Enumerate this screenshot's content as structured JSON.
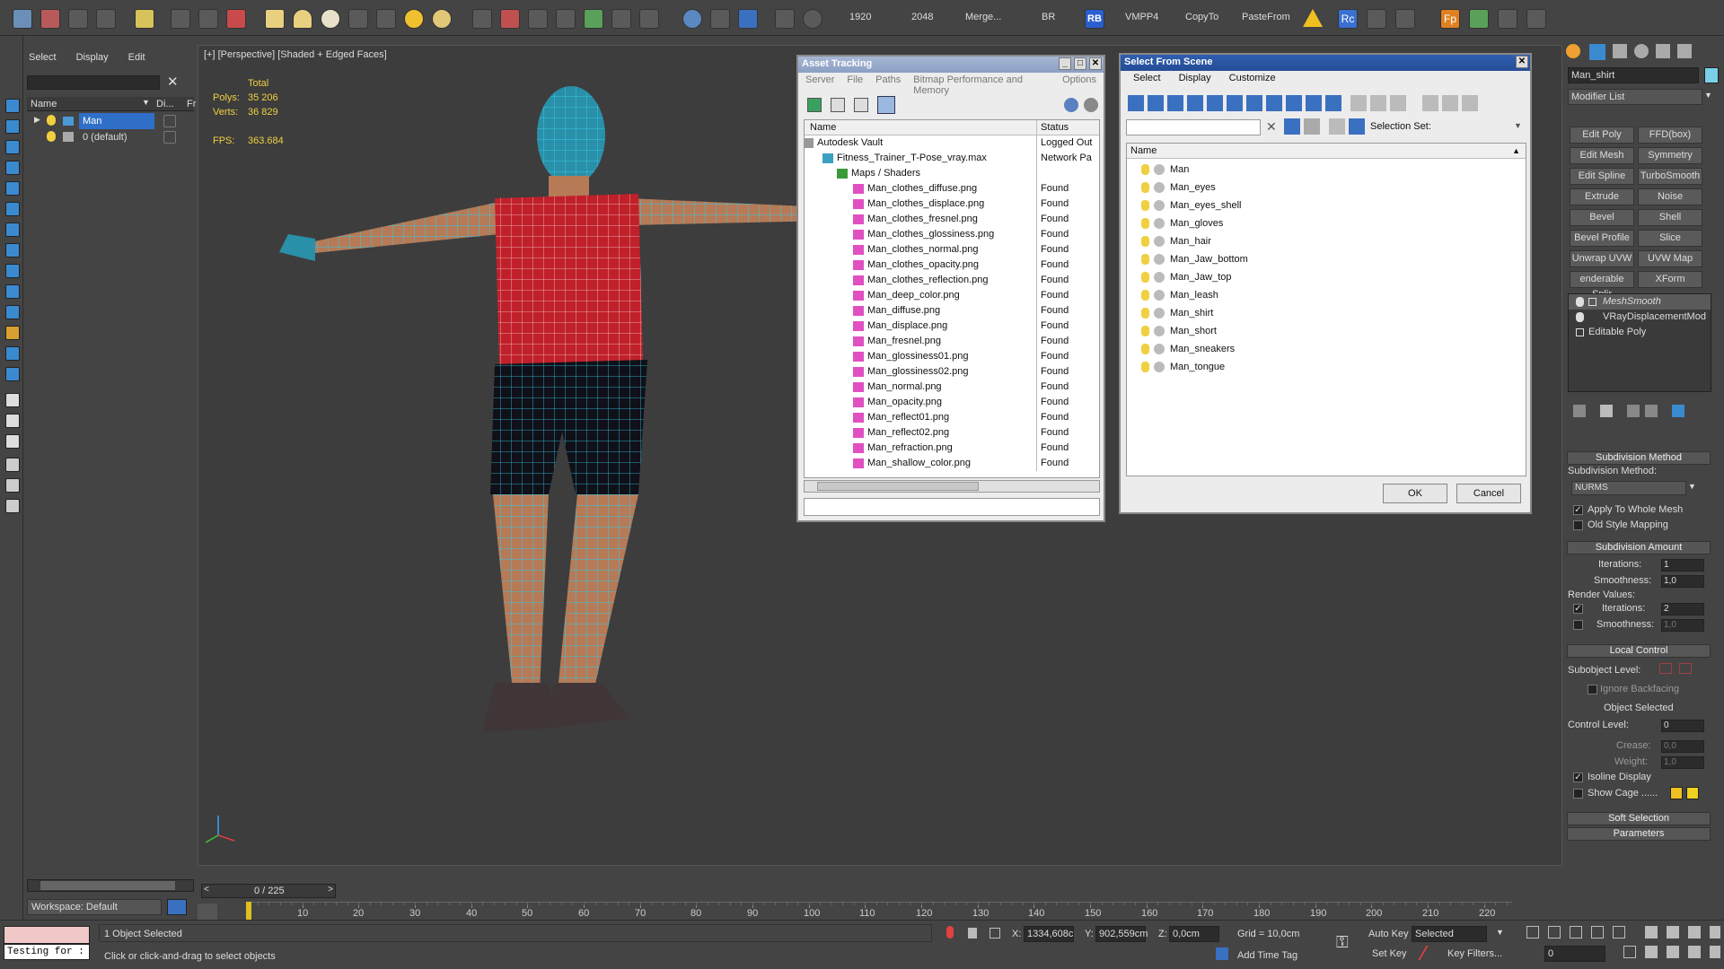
{
  "toolbar": {
    "render_w": "1920",
    "render_h": "2048",
    "merge": "Merge...",
    "br": "BR",
    "rb": "RB",
    "vmpp": "VMPP4",
    "copyto": "CopyTo",
    "pastefrom": "PasteFrom",
    "rc": "Rc",
    "fp": "Fp"
  },
  "scene_explorer": {
    "menu": [
      "Select",
      "Display",
      "Edit"
    ],
    "col_name": "Name",
    "col_di": "Di...",
    "col_fr": "Fr",
    "items": [
      {
        "label": "Man"
      },
      {
        "label": "0 (default)"
      }
    ],
    "workspace": "Workspace: Default"
  },
  "viewport": {
    "label": "[+] [Perspective] [Shaded + Edged Faces]",
    "stats_total": "Total",
    "polys_label": "Polys:",
    "polys_value": "35 206",
    "verts_label": "Verts:",
    "verts_value": "36 829",
    "fps_label": "FPS:",
    "fps_value": "363.684"
  },
  "asset_tracking": {
    "title": "Asset Tracking",
    "menu": [
      "Server",
      "File",
      "Paths",
      "Bitmap Performance and Memory",
      "Options"
    ],
    "col_name": "Name",
    "col_status": "Status",
    "rows": [
      {
        "name": "Autodesk Vault",
        "status": "Logged Out"
      },
      {
        "name": "Fitness_Trainer_T-Pose_vray.max",
        "status": "Network Pa"
      },
      {
        "name": "Maps / Shaders",
        "status": ""
      },
      {
        "name": "Man_clothes_diffuse.png",
        "status": "Found"
      },
      {
        "name": "Man_clothes_displace.png",
        "status": "Found"
      },
      {
        "name": "Man_clothes_fresnel.png",
        "status": "Found"
      },
      {
        "name": "Man_clothes_glossiness.png",
        "status": "Found"
      },
      {
        "name": "Man_clothes_normal.png",
        "status": "Found"
      },
      {
        "name": "Man_clothes_opacity.png",
        "status": "Found"
      },
      {
        "name": "Man_clothes_reflection.png",
        "status": "Found"
      },
      {
        "name": "Man_deep_color.png",
        "status": "Found"
      },
      {
        "name": "Man_diffuse.png",
        "status": "Found"
      },
      {
        "name": "Man_displace.png",
        "status": "Found"
      },
      {
        "name": "Man_fresnel.png",
        "status": "Found"
      },
      {
        "name": "Man_glossiness01.png",
        "status": "Found"
      },
      {
        "name": "Man_glossiness02.png",
        "status": "Found"
      },
      {
        "name": "Man_normal.png",
        "status": "Found"
      },
      {
        "name": "Man_opacity.png",
        "status": "Found"
      },
      {
        "name": "Man_reflect01.png",
        "status": "Found"
      },
      {
        "name": "Man_reflect02.png",
        "status": "Found"
      },
      {
        "name": "Man_refraction.png",
        "status": "Found"
      },
      {
        "name": "Man_shallow_color.png",
        "status": "Found"
      }
    ]
  },
  "select_from_scene": {
    "title": "Select From Scene",
    "menu": [
      "Select",
      "Display",
      "Customize"
    ],
    "selection_set": "Selection Set:",
    "col_name": "Name",
    "items": [
      "Man",
      "Man_eyes",
      "Man_eyes_shell",
      "Man_gloves",
      "Man_hair",
      "Man_Jaw_bottom",
      "Man_Jaw_top",
      "Man_leash",
      "Man_shirt",
      "Man_short",
      "Man_sneakers",
      "Man_tongue"
    ],
    "ok": "OK",
    "cancel": "Cancel"
  },
  "command_panel": {
    "object_name": "Man_shirt",
    "modifier_list": "Modifier List",
    "buttons": [
      [
        "Edit Poly",
        "FFD(box)"
      ],
      [
        "Edit Mesh",
        "Symmetry"
      ],
      [
        "Edit Spline",
        "TurboSmooth"
      ],
      [
        "Extrude",
        "Noise"
      ],
      [
        "Bevel",
        "Shell"
      ],
      [
        "Bevel Profile",
        "Slice"
      ],
      [
        "Unwrap UVW",
        "UVW Map"
      ],
      [
        "enderable Splir",
        "XForm"
      ]
    ],
    "stack": [
      "MeshSmooth",
      "VRayDisplacementMod",
      "Editable Poly"
    ],
    "subdiv_method_head": "Subdivision Method",
    "subdiv_method_label": "Subdivision Method:",
    "subdiv_method_value": "NURMS",
    "apply_whole": "Apply To Whole Mesh",
    "old_style": "Old Style Mapping",
    "subdiv_amount_head": "Subdivision Amount",
    "iterations_label": "Iterations:",
    "iterations_value": "1",
    "smoothness_label": "Smoothness:",
    "smoothness_value": "1,0",
    "render_values": "Render Values:",
    "r_iterations_label": "Iterations:",
    "r_iterations_value": "2",
    "r_smoothness_label": "Smoothness:",
    "r_smoothness_value": "1,0",
    "local_control_head": "Local Control",
    "subobject_level": "Subobject Level:",
    "ignore_backfacing": "Ignore Backfacing",
    "object_selected": "Object Selected",
    "control_level_label": "Control Level:",
    "control_level_value": "0",
    "crease_label": "Crease:",
    "crease_value": "0,0",
    "weight_label": "Weight:",
    "weight_value": "1,0",
    "isoline": "Isoline Display",
    "show_cage": "Show Cage ......",
    "soft_selection": "Soft Selection",
    "parameters": "Parameters"
  },
  "timeline": {
    "frame": "0 / 225",
    "ticks": [
      "10",
      "20",
      "30",
      "40",
      "50",
      "60",
      "70",
      "80",
      "90",
      "100",
      "110",
      "120",
      "130",
      "140",
      "150",
      "160",
      "170",
      "180",
      "190",
      "200",
      "210",
      "220"
    ]
  },
  "status": {
    "script": "Testing for :",
    "selected": "1 Object Selected",
    "prompt": "Click or click-and-drag to select objects",
    "x_label": "X:",
    "x_value": "1334,608c",
    "y_label": "Y:",
    "y_value": "902,559cm",
    "z_label": "Z:",
    "z_value": "0,0cm",
    "grid": "Grid = 10,0cm",
    "add_time_tag": "Add Time Tag",
    "auto_key": "Auto Key",
    "set_key": "Set Key",
    "key_mode": "Selected",
    "key_filters": "Key Filters...",
    "frame_field": "0"
  }
}
